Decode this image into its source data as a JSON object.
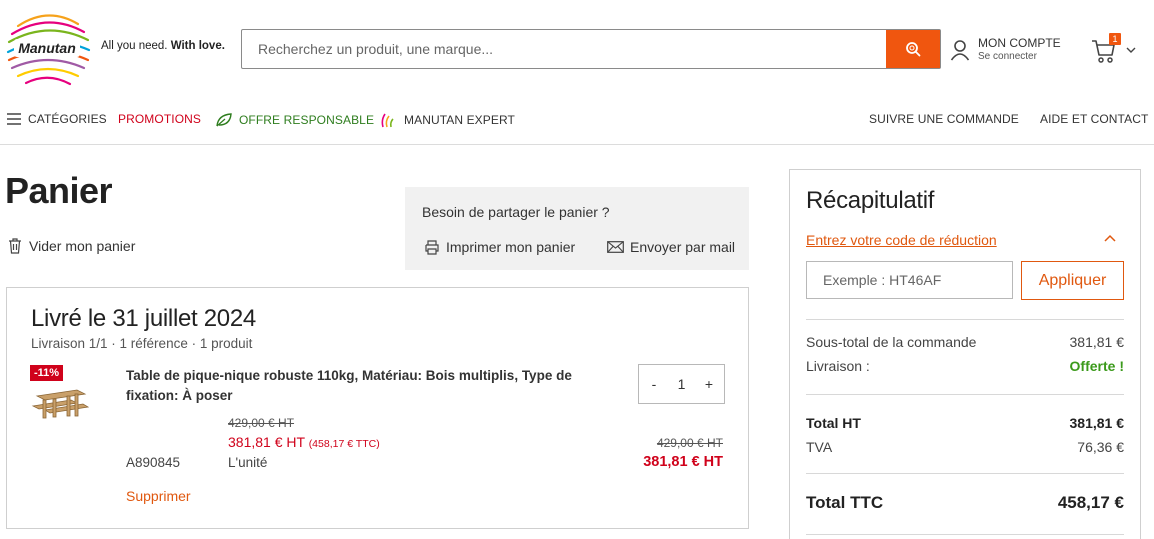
{
  "brand": {
    "tagline_plain": "All you need.",
    "tagline_bold": "With love."
  },
  "search": {
    "placeholder": "Recherchez un produit, une marque..."
  },
  "account": {
    "title": "MON COMPTE",
    "subtitle": "Se connecter"
  },
  "cart": {
    "badge": "1"
  },
  "nav": {
    "categories": "CATÉGORIES",
    "promotions": "PROMOTIONS",
    "responsible": "OFFRE RESPONSABLE",
    "expert": "MANUTAN EXPERT",
    "track": "SUIVRE UNE COMMANDE",
    "help": "AIDE ET CONTACT"
  },
  "page": {
    "title": "Panier",
    "empty_cart": "Vider mon panier"
  },
  "share": {
    "title": "Besoin de partager le panier ?",
    "print": "Imprimer mon panier",
    "mail": "Envoyer par mail"
  },
  "delivery": {
    "title": "Livré le 31 juillet 2024",
    "meta": "Livraison 1/1  · 1 référence  · 1 produit"
  },
  "product": {
    "badge": "-11%",
    "name": "Table de pique-nique robuste 110kg, Matériau: Bois multiplis, Type de fixation: À poser",
    "quantity": "1",
    "qty_minus": "-",
    "qty_plus": "+",
    "old_unit_price": "429,00 € HT",
    "unit_price": "381,81 €  HT",
    "unit_price_ttc": "(458,17 € TTC)",
    "sku": "A890845",
    "unit_label": "L'unité",
    "old_total": "429,00 € HT",
    "total": "381,81 €  HT",
    "remove": "Supprimer"
  },
  "summary": {
    "title": "Récapitulatif",
    "promo_link": "Entrez votre code de réduction",
    "promo_placeholder": "Exemple : HT46AF",
    "apply": "Appliquer",
    "subtotal_label": "Sous-total de la commande",
    "subtotal_value": "381,81 €",
    "shipping_label": "Livraison :",
    "shipping_value": "Offerte !",
    "total_ht_label": "Total HT",
    "total_ht_value": "381,81 €",
    "tva_label": "TVA",
    "tva_value": "76,36 €",
    "total_ttc_label": "Total TTC",
    "total_ttc_value": "458,17 €"
  },
  "colors": {
    "accent": "#f0560f",
    "link": "#e0580f",
    "promo": "#d0021b",
    "free": "#3b9a1b",
    "responsible": "#2e7d1e"
  },
  "icons": [
    "logo-mark",
    "search-icon",
    "user-icon",
    "cart-icon",
    "chevron-down-icon",
    "menu-icon",
    "leaf-icon",
    "expert-icon",
    "trash-icon",
    "printer-icon",
    "mail-icon",
    "chevron-up-icon"
  ]
}
